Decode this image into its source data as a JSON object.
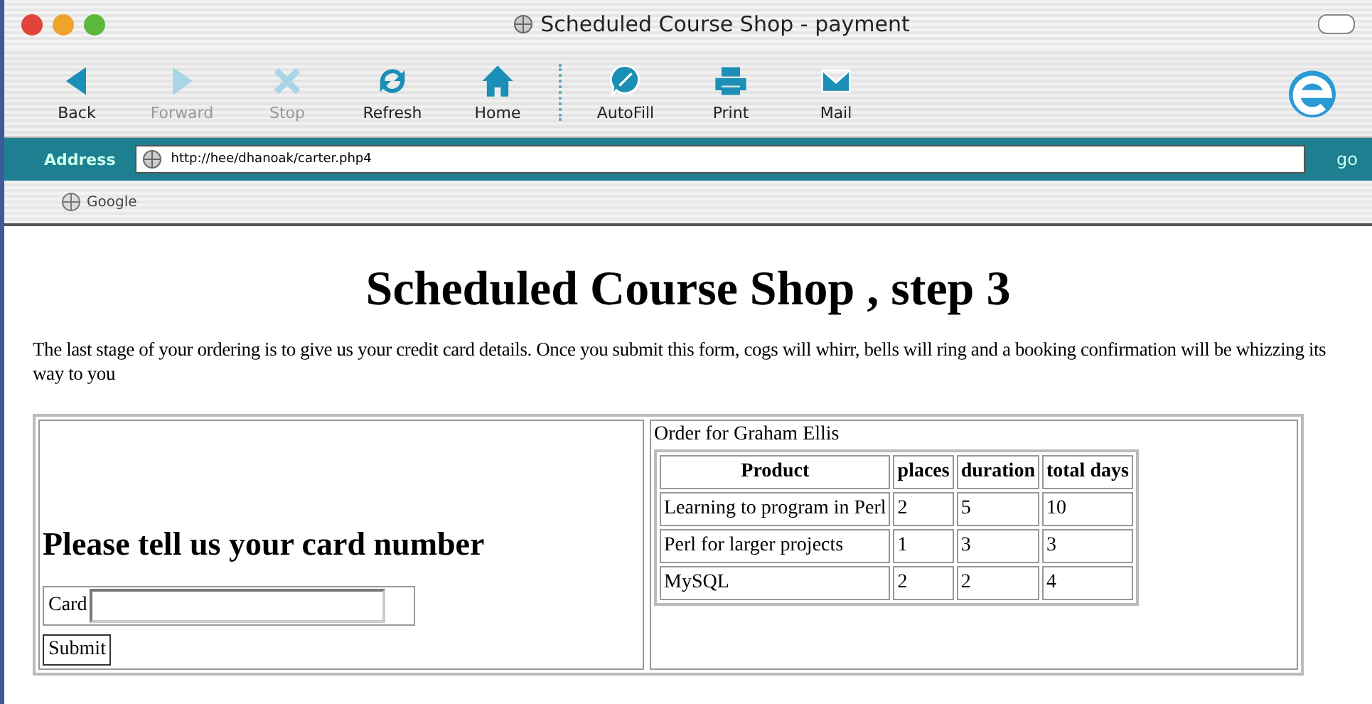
{
  "window": {
    "title": "Scheduled Course Shop  - payment"
  },
  "toolbar": [
    {
      "label": "Back",
      "kind": "back",
      "disabled": false
    },
    {
      "label": "Forward",
      "kind": "forward",
      "disabled": true
    },
    {
      "label": "Stop",
      "kind": "stop",
      "disabled": true
    },
    {
      "label": "Refresh",
      "kind": "refresh",
      "disabled": false
    },
    {
      "label": "Home",
      "kind": "home",
      "disabled": false
    },
    {
      "label": "AutoFill",
      "kind": "autofill",
      "disabled": false
    },
    {
      "label": "Print",
      "kind": "print",
      "disabled": false
    },
    {
      "label": "Mail",
      "kind": "mail",
      "disabled": false
    }
  ],
  "address_bar": {
    "label": "Address",
    "value": "http://hee/dhanoak/carter.php4",
    "go": "go"
  },
  "favorites": [
    {
      "label": "Google"
    }
  ],
  "page": {
    "heading": "Scheduled Course Shop , step 3",
    "intro": "The last stage of your ordering is to give us your credit card details. Once you submit this form, cogs will whirr, bells will ring and a booking confirmation will be whizzing its way to you",
    "form": {
      "heading": "Please tell us your card number",
      "card_label": "Card",
      "submit": "Submit"
    },
    "order": {
      "caption": "Order for Graham Ellis",
      "columns": [
        "Product",
        "places",
        "duration",
        "total days"
      ],
      "rows": [
        [
          "Learning to program in Perl",
          "2",
          "5",
          "10"
        ],
        [
          "Perl for larger projects",
          "1",
          "3",
          "3"
        ],
        [
          "MySQL",
          "2",
          "2",
          "4"
        ]
      ]
    }
  }
}
